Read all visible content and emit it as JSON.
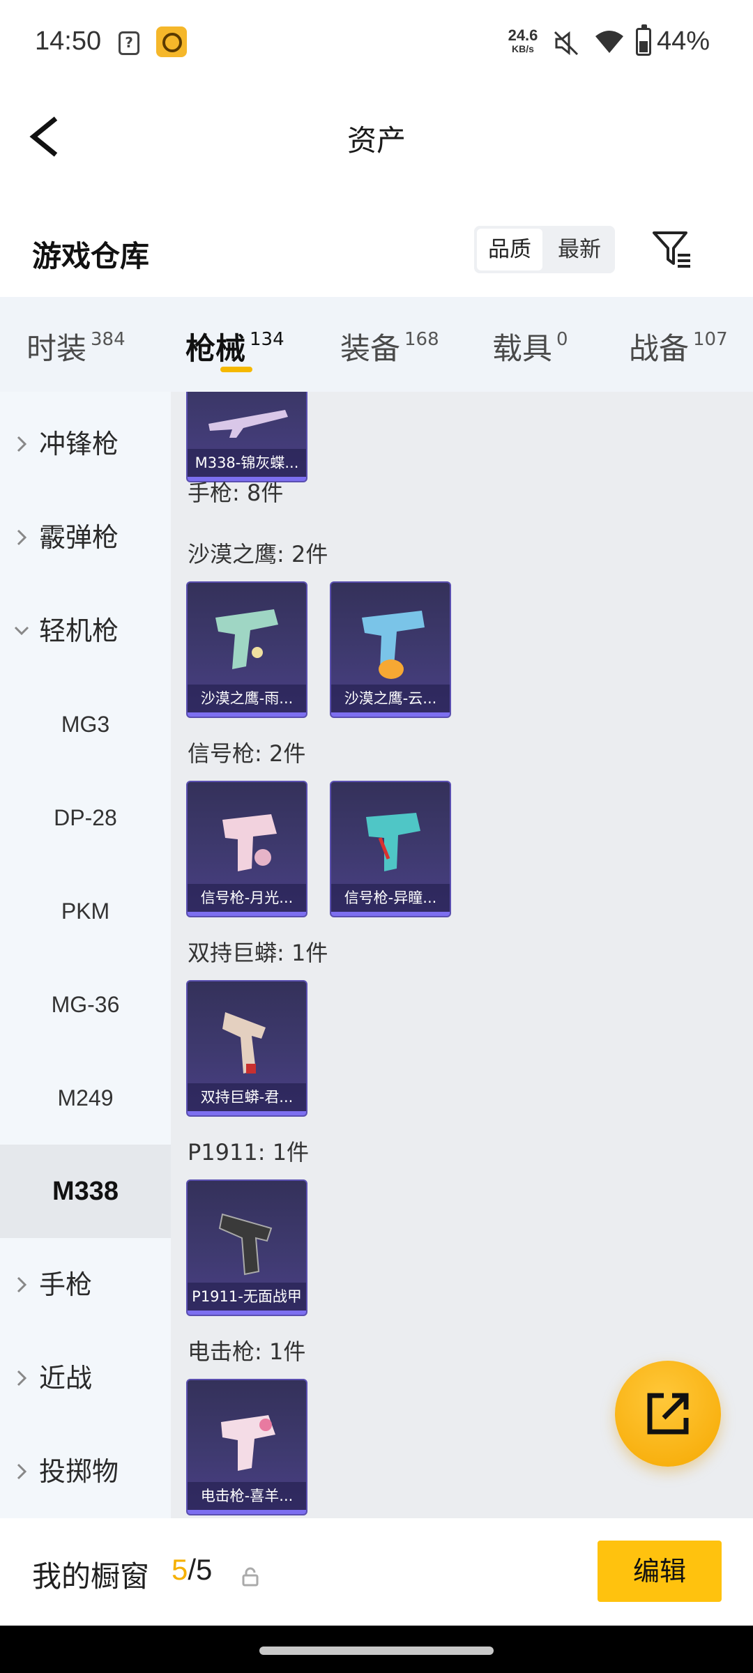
{
  "status_bar": {
    "time": "14:50",
    "speed_value": "24.6",
    "speed_unit": "KB/s",
    "battery": "44%"
  },
  "header": {
    "title": "资产"
  },
  "section": {
    "title": "游戏仓库",
    "sort_options": [
      "品质",
      "最新"
    ],
    "active_sort": "品质"
  },
  "tabs": [
    {
      "label": "时装",
      "count": "384"
    },
    {
      "label": "枪械",
      "count": "134",
      "active": true
    },
    {
      "label": "装备",
      "count": "168"
    },
    {
      "label": "载具",
      "count": "0"
    },
    {
      "label": "战备",
      "count": "107"
    }
  ],
  "sidebar": {
    "categories": [
      {
        "label": "冲锋枪"
      },
      {
        "label": "霰弹枪"
      },
      {
        "label": "轻机枪",
        "expanded": true
      }
    ],
    "sub_items": [
      "MG3",
      "DP-28",
      "PKM",
      "MG-36",
      "M249",
      "M338"
    ],
    "active_sub": "M338",
    "categories_after": [
      {
        "label": "手枪"
      },
      {
        "label": "近战"
      },
      {
        "label": "投掷物"
      }
    ]
  },
  "content": {
    "top_card": {
      "name": "M338-锦灰蝶..."
    },
    "category_header": "手枪: 8件",
    "groups": [
      {
        "title": "沙漠之鹰: 2件",
        "items": [
          {
            "name": "沙漠之鹰-雨..."
          },
          {
            "name": "沙漠之鹰-云..."
          }
        ]
      },
      {
        "title": "信号枪: 2件",
        "items": [
          {
            "name": "信号枪-月光..."
          },
          {
            "name": "信号枪-异瞳..."
          }
        ]
      },
      {
        "title": "双持巨蟒: 1件",
        "items": [
          {
            "name": "双持巨蟒-君..."
          }
        ]
      },
      {
        "title": "P1911: 1件",
        "items": [
          {
            "name": "P1911-无面战甲"
          }
        ]
      },
      {
        "title": "电击枪: 1件",
        "items": [
          {
            "name": "电击枪-喜羊..."
          }
        ]
      }
    ]
  },
  "bottom_bar": {
    "showcase_label": "我的橱窗",
    "showcase_current": "5",
    "showcase_sep_total": "/5",
    "edit_label": "编辑"
  },
  "colors": {
    "accent": "#f5b800",
    "card_bg": "#3f3a70",
    "sidebar_bg": "#f3f7fb",
    "content_bg": "#ebedf0"
  }
}
